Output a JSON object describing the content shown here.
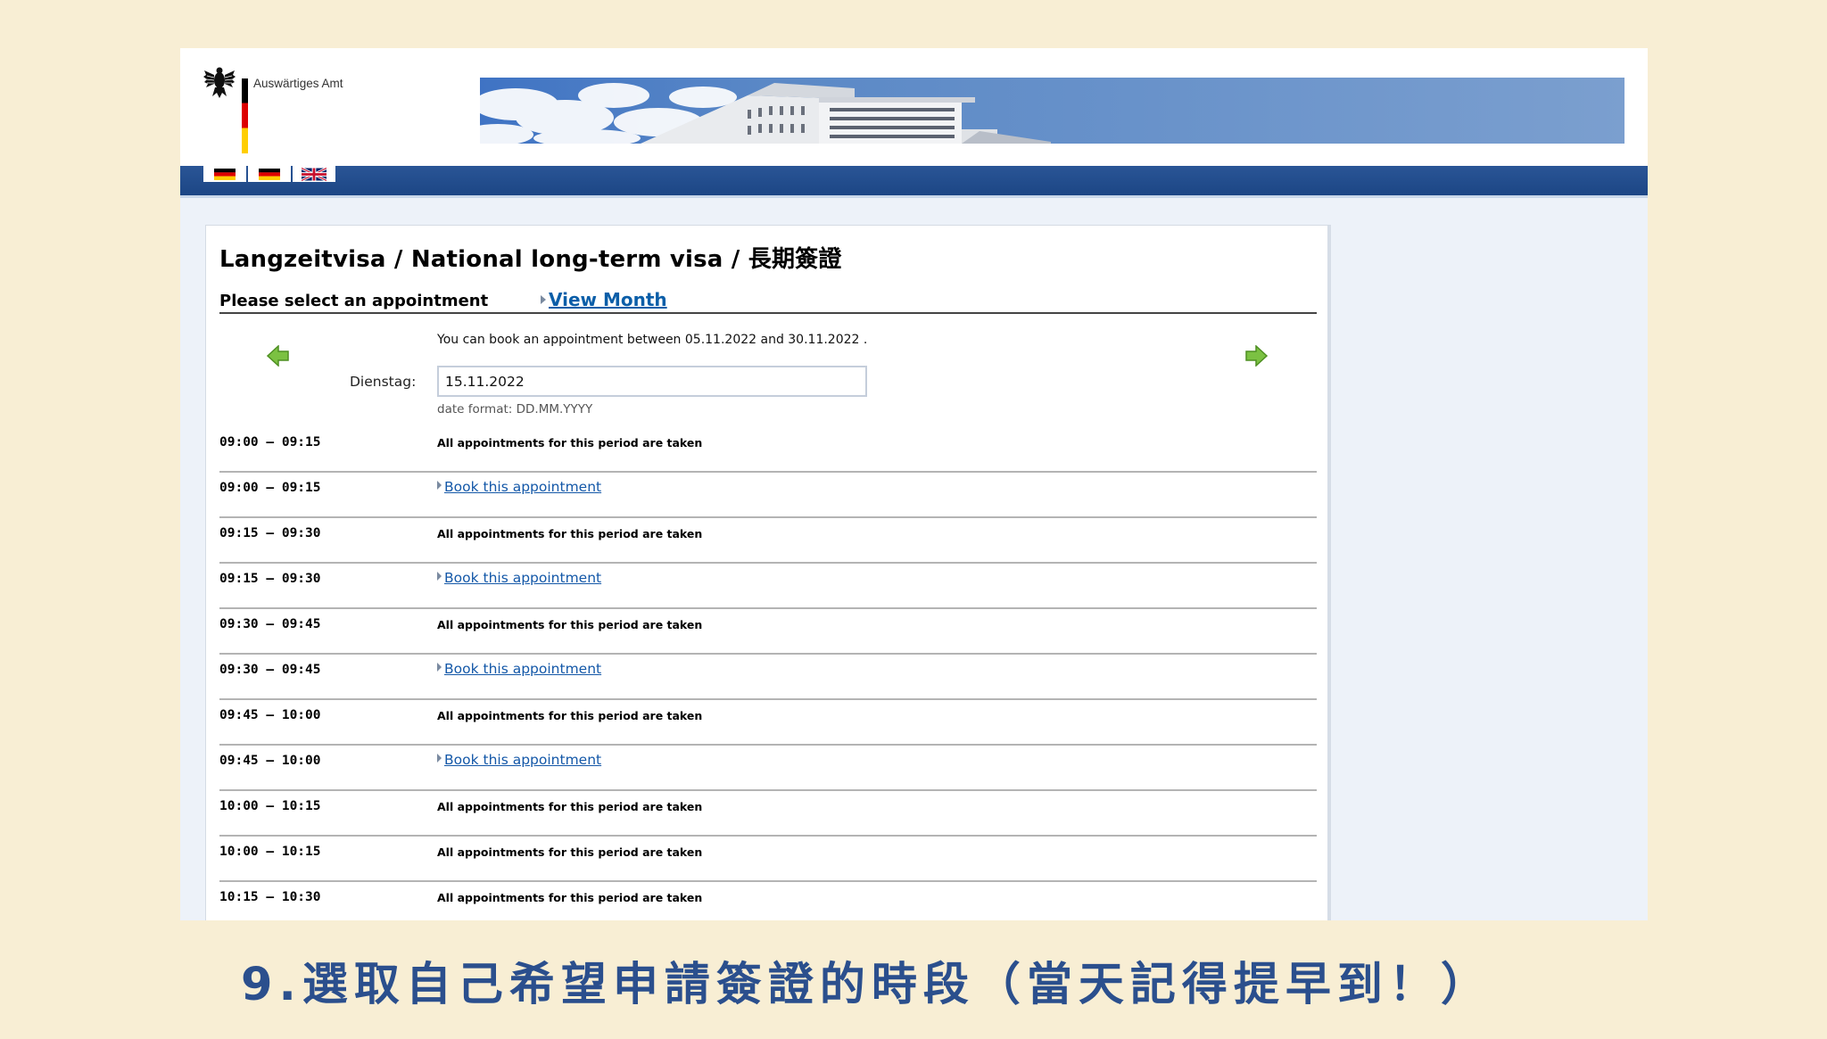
{
  "header": {
    "logo_text": "Auswärtiges Amt"
  },
  "page": {
    "title": "Langzeitvisa / National long-term visa / 長期簽證",
    "subheading": "Please select an appointment",
    "view_month_link": "View Month",
    "info_text": "You can book an appointment between 05.11.2022 and 30.11.2022 .",
    "day_label": "Dienstag:",
    "date_value": "15.11.2022",
    "date_format_hint": "date format: DD.MM.YYYY"
  },
  "slots": [
    {
      "time": "09:00 — 09:15",
      "status": "All appointments for this period are taken",
      "bookable": false
    },
    {
      "time": "09:00 — 09:15",
      "status": "Book this appointment",
      "bookable": true
    },
    {
      "time": "09:15 — 09:30",
      "status": "All appointments for this period are taken",
      "bookable": false
    },
    {
      "time": "09:15 — 09:30",
      "status": "Book this appointment",
      "bookable": true
    },
    {
      "time": "09:30 — 09:45",
      "status": "All appointments for this period are taken",
      "bookable": false
    },
    {
      "time": "09:30 — 09:45",
      "status": "Book this appointment",
      "bookable": true
    },
    {
      "time": "09:45 — 10:00",
      "status": "All appointments for this period are taken",
      "bookable": false
    },
    {
      "time": "09:45 — 10:00",
      "status": "Book this appointment",
      "bookable": true
    },
    {
      "time": "10:00 — 10:15",
      "status": "All appointments for this period are taken",
      "bookable": false
    },
    {
      "time": "10:00 — 10:15",
      "status": "All appointments for this period are taken",
      "bookable": false
    },
    {
      "time": "10:15 — 10:30",
      "status": "All appointments for this period are taken",
      "bookable": false
    }
  ],
  "caption": "9.選取自己希望申請簽證的時段（當天記得提早到！）",
  "colors": {
    "background": "#f8eed4",
    "nav_blue": "#1c4685",
    "link_blue": "#1458a8",
    "arrow_green": "#6bb82e",
    "caption_blue": "#2b4f8d"
  },
  "icons": [
    "eagle-icon",
    "de-flag-icon",
    "uk-flag-icon",
    "prev-arrow-icon",
    "next-arrow-icon"
  ]
}
